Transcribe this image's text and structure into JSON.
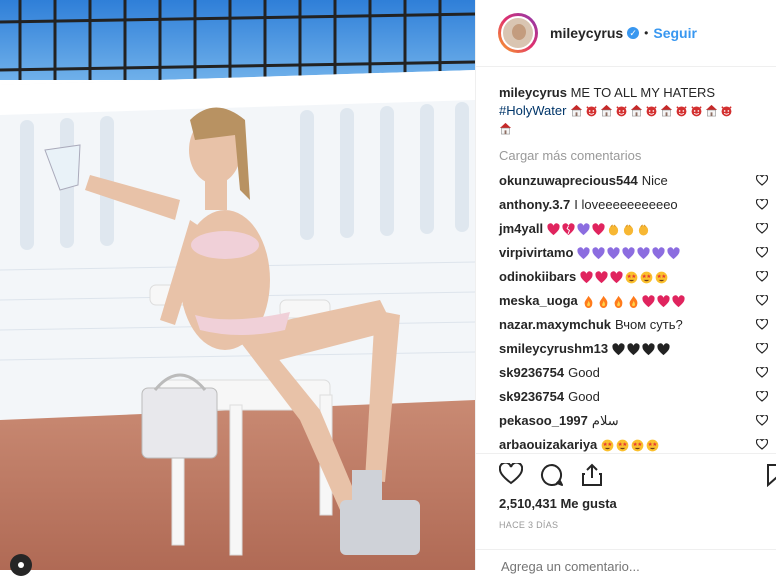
{
  "header": {
    "username": "mileycyrus",
    "follow_label": "Seguir",
    "dot": "•"
  },
  "caption": {
    "username": "mileycyrus",
    "text": "ME TO ALL MY HATERS",
    "hashtag": "#HolyWater",
    "emojis": [
      "house",
      "devil",
      "house",
      "devil",
      "house",
      "devil",
      "house",
      "devil",
      "devil",
      "house",
      "devil",
      "house"
    ]
  },
  "load_more_label": "Cargar más comentarios",
  "comments": [
    {
      "user": "okunzuwaprecious544",
      "text": "Nice",
      "emojis": []
    },
    {
      "user": "anthony.3.7",
      "text": "I loveeeeeeeeeeo",
      "emojis": []
    },
    {
      "user": "jm4yall",
      "text": "",
      "emojis": [
        "red-heart",
        "broken-heart",
        "purple-heart",
        "red-heart",
        "clap",
        "clap",
        "clap"
      ]
    },
    {
      "user": "virpivirtamo",
      "text": "",
      "emojis": [
        "purple-heart",
        "purple-heart",
        "purple-heart",
        "purple-heart",
        "purple-heart",
        "purple-heart",
        "purple-heart"
      ]
    },
    {
      "user": "odinokiibars",
      "text": "",
      "emojis": [
        "red-heart",
        "red-heart",
        "red-heart",
        "star-eyes",
        "star-eyes",
        "star-eyes"
      ]
    },
    {
      "user": "meska_uoga",
      "text": "",
      "emojis": [
        "fire",
        "fire",
        "fire",
        "fire",
        "red-heart",
        "red-heart",
        "red-heart"
      ]
    },
    {
      "user": "nazar.maxymchuk",
      "text": "Вчом суть?",
      "emojis": []
    },
    {
      "user": "smileycyrushm13",
      "text": "",
      "emojis": [
        "black-heart",
        "black-heart",
        "black-heart",
        "black-heart"
      ]
    },
    {
      "user": "sk9236754",
      "text": "Good",
      "emojis": []
    },
    {
      "user": "sk9236754",
      "text": "Good",
      "emojis": []
    },
    {
      "user": "pekasoo_1997",
      "text": "سلام",
      "emojis": []
    },
    {
      "user": "arbaouizakariya",
      "text": "",
      "emojis": [
        "star-eyes",
        "star-eyes",
        "star-eyes",
        "star-eyes"
      ]
    }
  ],
  "likes_label": "2,510,431 Me gusta",
  "time_label": "HACE 3 DÍAS",
  "add_comment_placeholder": "Agrega un comentario...",
  "icons": {
    "like": "heart-icon",
    "comment": "comment-icon",
    "share": "share-icon",
    "save": "bookmark-icon"
  },
  "colors": {
    "link_blue": "#3897f0",
    "hashtag": "#003569",
    "muted": "#999999"
  }
}
